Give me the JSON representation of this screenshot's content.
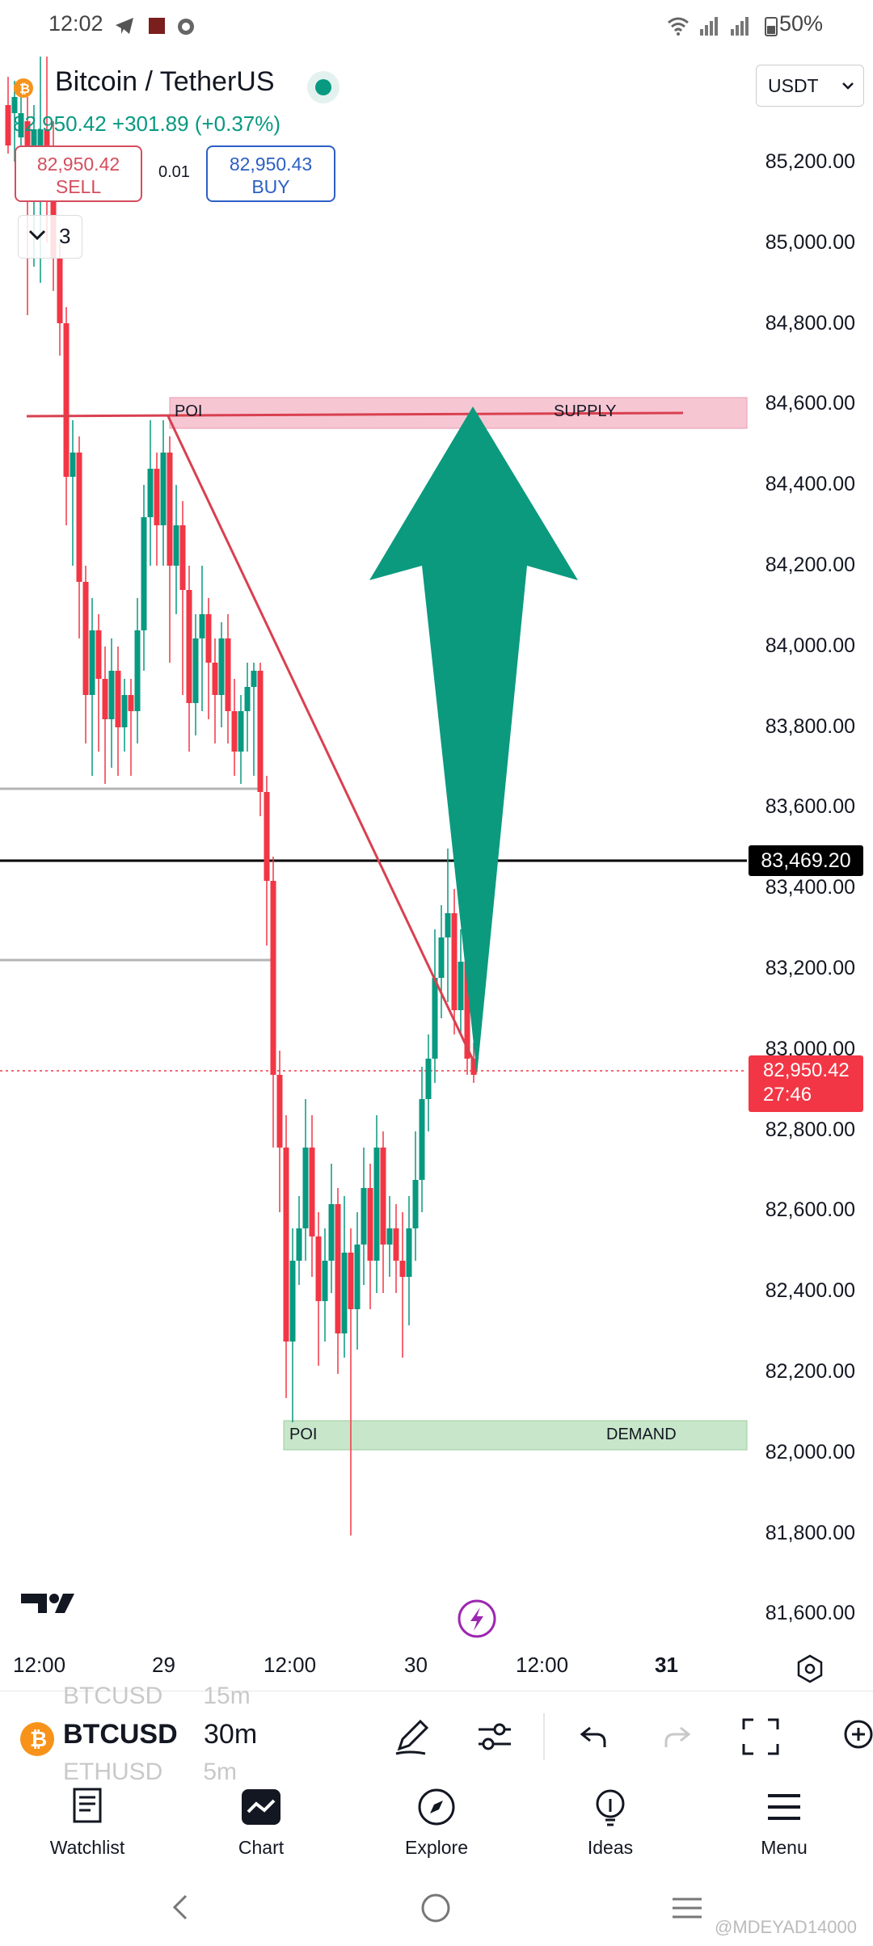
{
  "status_bar": {
    "time": "12:02",
    "battery": "50%"
  },
  "symbol": {
    "title": "Bitcoin / TetherUS",
    "price_change": "82,950.42 +301.89 (+0.37%)",
    "sell_price": "82,950.42",
    "sell_label": "SELL",
    "spread": "0.01",
    "buy_price": "82,950.43",
    "buy_label": "BUY",
    "indicator_count": "3",
    "currency": "USDT"
  },
  "price_axis": [
    "85,200.00",
    "85,000.00",
    "84,800.00",
    "84,600.00",
    "84,400.00",
    "84,200.00",
    "84,000.00",
    "83,800.00",
    "83,600.00",
    "83,400.00",
    "83,200.00",
    "83,000.00",
    "82,800.00",
    "82,600.00",
    "82,400.00",
    "82,200.00",
    "82,000.00",
    "81,800.00",
    "81,600.00"
  ],
  "crosshair_price": "83,469.20",
  "current_price": {
    "price": "82,950.42",
    "countdown": "27:46"
  },
  "time_axis": [
    "12:00",
    "29",
    "12:00",
    "30",
    "12:00",
    "31"
  ],
  "zones": {
    "supply": {
      "left": "POI",
      "right": "SUPPLY"
    },
    "demand": {
      "left": "POI",
      "right": "DEMAND"
    }
  },
  "toolbar": {
    "symbol": "BTCUSD",
    "interval": "30m",
    "ghost_above": "BTCUSD      15m",
    "ghost_below": "ETHUSD      5m"
  },
  "nav": [
    {
      "label": "Watchlist"
    },
    {
      "label": "Chart"
    },
    {
      "label": "Explore"
    },
    {
      "label": "Ideas"
    },
    {
      "label": "Menu"
    }
  ],
  "watermark": "@MDEYAD14000",
  "colors": {
    "up": "#089981",
    "down": "#f23645",
    "supply_zone": "#f7c6d3",
    "demand_zone": "#c8e6c9",
    "arrow": "#0b9a7e",
    "trendline": "#d9404f"
  }
}
